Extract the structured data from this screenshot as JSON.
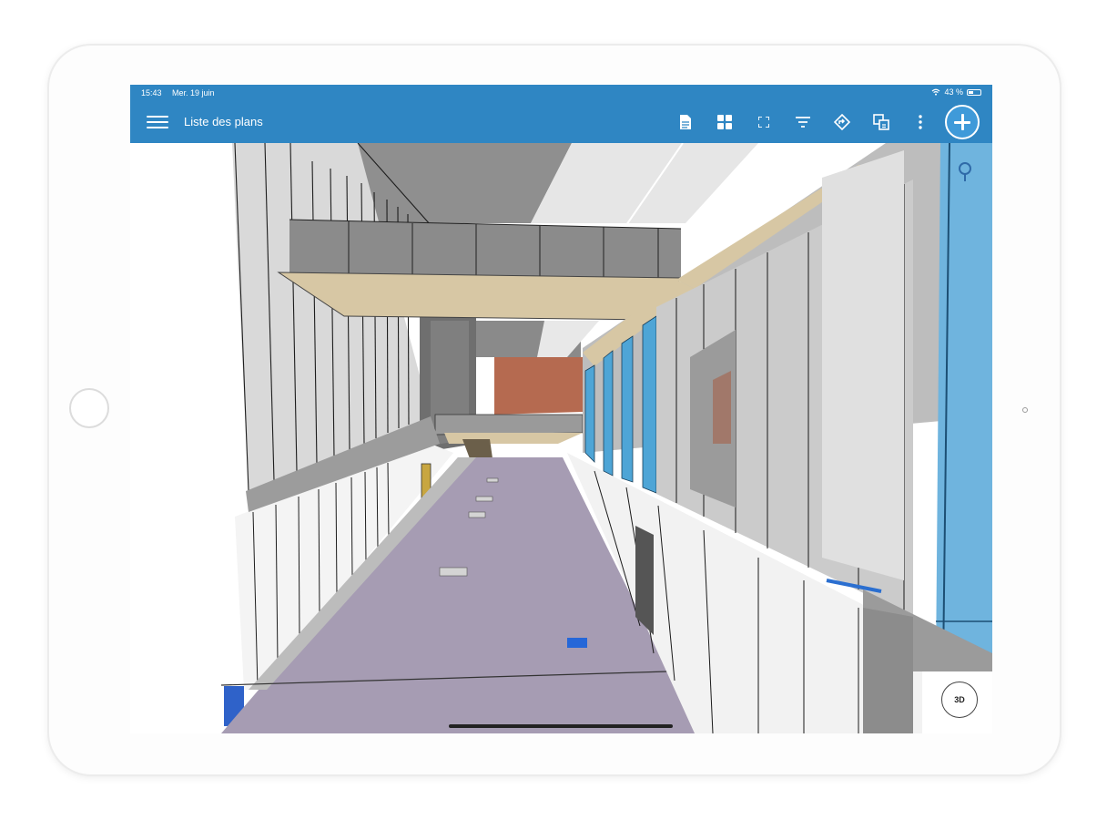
{
  "status_bar": {
    "time": "15:43",
    "date": "Mer. 19 juin",
    "battery": "43 %",
    "battery_level": 0.43
  },
  "app_bar": {
    "menu_icon": "hamburger-menu-icon",
    "title": "Liste des plans",
    "tools": [
      {
        "name": "document-icon"
      },
      {
        "name": "grid-icon"
      },
      {
        "name": "fullscreen-icon"
      },
      {
        "name": "filter-icon"
      },
      {
        "name": "navigate-icon"
      },
      {
        "name": "layers-icon"
      },
      {
        "name": "more-vertical-icon"
      }
    ],
    "add_button_icon": "plus-icon"
  },
  "viewport": {
    "marker_icon": "location-pin-icon",
    "view_toggle_label": "3D"
  },
  "colors": {
    "accent": "#2f86c3",
    "fab": "#3f9ad9",
    "floor": "#a69cb3",
    "glass": "#6fb4de",
    "wood": "#d7c7a4",
    "brick": "#b56a50"
  }
}
